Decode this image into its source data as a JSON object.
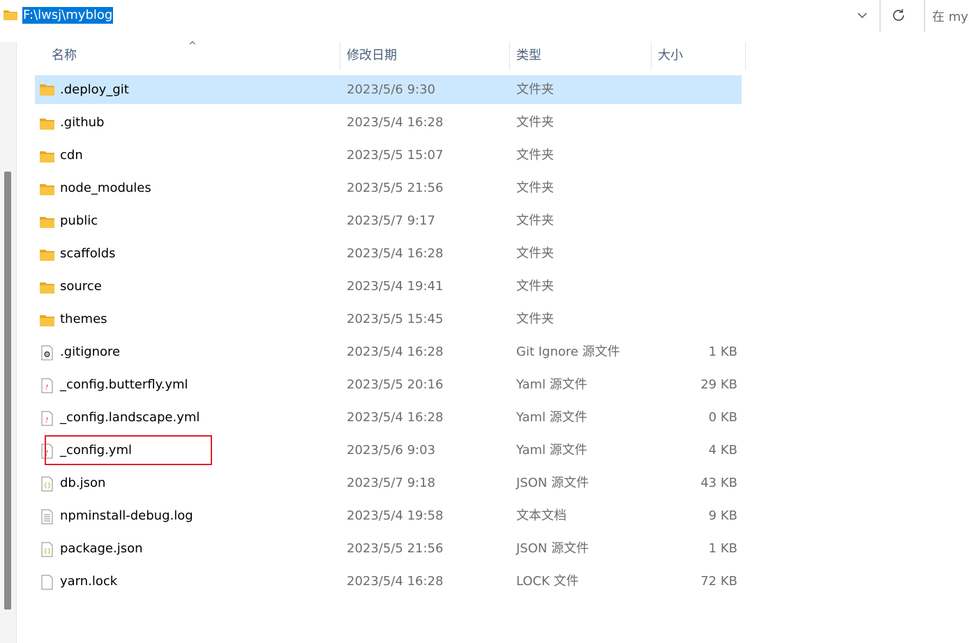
{
  "address_bar": {
    "path": "F:\\lwsj\\myblog",
    "search_placeholder": "在 myblog 中搜索"
  },
  "columns": {
    "name": "名称",
    "date": "修改日期",
    "type": "类型",
    "size": "大小",
    "sort_indicator": "^"
  },
  "files": [
    {
      "name": ".deploy_git",
      "date": "2023/5/6 9:30",
      "type": "文件夹",
      "size": "",
      "icon": "folder-icon",
      "selected": true
    },
    {
      "name": ".github",
      "date": "2023/5/4 16:28",
      "type": "文件夹",
      "size": "",
      "icon": "folder-icon"
    },
    {
      "name": "cdn",
      "date": "2023/5/5 15:07",
      "type": "文件夹",
      "size": "",
      "icon": "folder-icon"
    },
    {
      "name": "node_modules",
      "date": "2023/5/5 21:56",
      "type": "文件夹",
      "size": "",
      "icon": "folder-icon"
    },
    {
      "name": "public",
      "date": "2023/5/7 9:17",
      "type": "文件夹",
      "size": "",
      "icon": "folder-icon"
    },
    {
      "name": "scaffolds",
      "date": "2023/5/4 16:28",
      "type": "文件夹",
      "size": "",
      "icon": "folder-icon"
    },
    {
      "name": "source",
      "date": "2023/5/4 19:41",
      "type": "文件夹",
      "size": "",
      "icon": "folder-icon"
    },
    {
      "name": "themes",
      "date": "2023/5/5 15:45",
      "type": "文件夹",
      "size": "",
      "icon": "folder-icon"
    },
    {
      "name": ".gitignore",
      "date": "2023/5/4 16:28",
      "type": "Git Ignore 源文件",
      "size": "1 KB",
      "icon": "settings-file-icon"
    },
    {
      "name": "_config.butterfly.yml",
      "date": "2023/5/5 20:16",
      "type": "Yaml 源文件",
      "size": "29 KB",
      "icon": "yaml-file-icon"
    },
    {
      "name": "_config.landscape.yml",
      "date": "2023/5/4 16:28",
      "type": "Yaml 源文件",
      "size": "0 KB",
      "icon": "yaml-file-icon"
    },
    {
      "name": "_config.yml",
      "date": "2023/5/6 9:03",
      "type": "Yaml 源文件",
      "size": "4 KB",
      "icon": "yaml-file-icon",
      "highlighted": true
    },
    {
      "name": "db.json",
      "date": "2023/5/7 9:18",
      "type": "JSON 源文件",
      "size": "43 KB",
      "icon": "json-file-icon"
    },
    {
      "name": "npminstall-debug.log",
      "date": "2023/5/4 19:58",
      "type": "文本文档",
      "size": "9 KB",
      "icon": "text-file-icon"
    },
    {
      "name": "package.json",
      "date": "2023/5/5 21:56",
      "type": "JSON 源文件",
      "size": "1 KB",
      "icon": "json-file-icon"
    },
    {
      "name": "yarn.lock",
      "date": "2023/5/4 16:28",
      "type": "LOCK 文件",
      "size": "72 KB",
      "icon": "blank-file-icon"
    }
  ],
  "colors": {
    "selection": "#cce8ff",
    "address_highlight": "#0078d7",
    "annotation_box": "#e0202c",
    "folder": "#f8c443"
  }
}
